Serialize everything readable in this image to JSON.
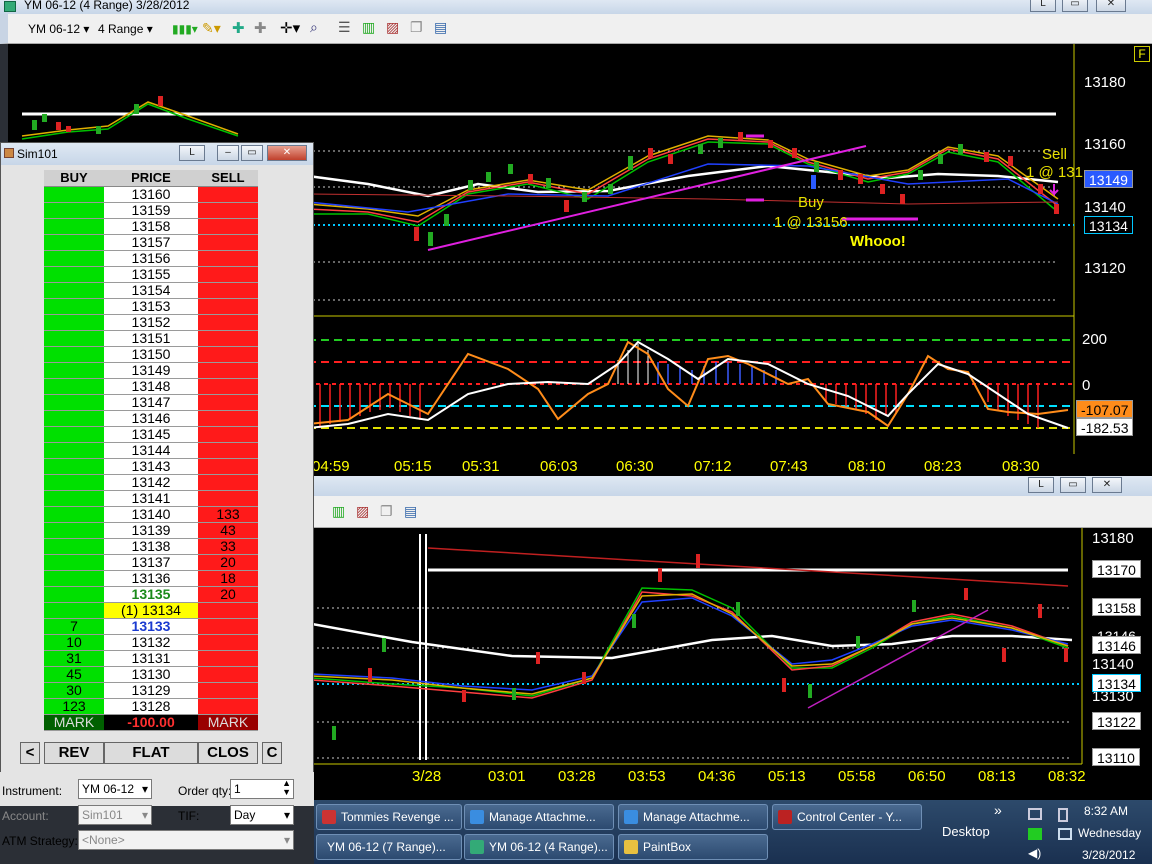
{
  "main_window": {
    "title": "YM 06-12 (4 Range)  3/28/2012",
    "instrument": "YM 06-12",
    "interval": "4 Range",
    "right_marker": "F",
    "minimize": "L"
  },
  "top_chart": {
    "price_labels": [
      "13180",
      "13160",
      "13140",
      "13120"
    ],
    "last_price_tag": "13149",
    "cyan_tag": "13134",
    "sell_text": "Sell",
    "sell_fill": "1 @ 131",
    "buy_text": "Buy",
    "buy_fill": "1 @ 13156",
    "whooo_text": "Whooo!",
    "indicator_labels": [
      "200",
      "0"
    ],
    "orange_tag": "-107.07",
    "white_tag": "-182.53",
    "time_labels": [
      "04:59",
      "05:15",
      "05:31",
      "06:03",
      "06:30",
      "07:12",
      "07:43",
      "08:10",
      "08:23",
      "08:30"
    ]
  },
  "bottom_chart": {
    "price_labels": [
      "13180",
      "13140",
      "13130"
    ],
    "tags": [
      "13170",
      "13158",
      "13146",
      "13134",
      "13122",
      "13110"
    ],
    "hidden_tag": "13146",
    "time_labels": [
      "3/28",
      "03:01",
      "03:28",
      "03:53",
      "04:36",
      "05:13",
      "05:58",
      "06:50",
      "08:13",
      "08:32"
    ],
    "minimize": "L"
  },
  "dom": {
    "title": "Sim101",
    "minimize": "L",
    "headers": {
      "buy": "BUY",
      "price": "PRICE",
      "sell": "SELL"
    },
    "rows": [
      {
        "buy": "",
        "price": "13160",
        "sell": ""
      },
      {
        "buy": "",
        "price": "13159",
        "sell": ""
      },
      {
        "buy": "",
        "price": "13158",
        "sell": ""
      },
      {
        "buy": "",
        "price": "13157",
        "sell": ""
      },
      {
        "buy": "",
        "price": "13156",
        "sell": ""
      },
      {
        "buy": "",
        "price": "13155",
        "sell": ""
      },
      {
        "buy": "",
        "price": "13154",
        "sell": ""
      },
      {
        "buy": "",
        "price": "13153",
        "sell": ""
      },
      {
        "buy": "",
        "price": "13152",
        "sell": ""
      },
      {
        "buy": "",
        "price": "13151",
        "sell": ""
      },
      {
        "buy": "",
        "price": "13150",
        "sell": ""
      },
      {
        "buy": "",
        "price": "13149",
        "sell": ""
      },
      {
        "buy": "",
        "price": "13148",
        "sell": ""
      },
      {
        "buy": "",
        "price": "13147",
        "sell": ""
      },
      {
        "buy": "",
        "price": "13146",
        "sell": ""
      },
      {
        "buy": "",
        "price": "13145",
        "sell": ""
      },
      {
        "buy": "",
        "price": "13144",
        "sell": ""
      },
      {
        "buy": "",
        "price": "13143",
        "sell": ""
      },
      {
        "buy": "",
        "price": "13142",
        "sell": ""
      },
      {
        "buy": "",
        "price": "13141",
        "sell": ""
      },
      {
        "buy": "",
        "price": "13140",
        "sell": "133"
      },
      {
        "buy": "",
        "price": "13139",
        "sell": "43"
      },
      {
        "buy": "",
        "price": "13138",
        "sell": "33"
      },
      {
        "buy": "",
        "price": "13137",
        "sell": "20"
      },
      {
        "buy": "",
        "price": "13136",
        "sell": "18"
      },
      {
        "buy": "",
        "price": "13135",
        "sell": "20",
        "style": "ask"
      },
      {
        "buy": "",
        "price": "(1) 13134",
        "sell": "",
        "style": "position"
      },
      {
        "buy": "7",
        "price": "13133",
        "sell": "",
        "style": "bid"
      },
      {
        "buy": "10",
        "price": "13132",
        "sell": ""
      },
      {
        "buy": "31",
        "price": "13131",
        "sell": ""
      },
      {
        "buy": "45",
        "price": "13130",
        "sell": ""
      },
      {
        "buy": "30",
        "price": "13129",
        "sell": ""
      },
      {
        "buy": "123",
        "price": "13128",
        "sell": ""
      }
    ],
    "mark_left": "MARK",
    "pnl": "-100.00",
    "mark_right": "MARK",
    "buttons": {
      "left": "<",
      "rev": "REV",
      "flat": "FLAT",
      "clos": "CLOS",
      "c": "C"
    },
    "form": {
      "instrument_label": "Instrument:",
      "instrument_value": "YM 06-12",
      "account_label": "Account:",
      "account_value": "Sim101",
      "atm_label": "ATM Strategy:",
      "atm_value": "<None>",
      "qty_label": "Order qty:",
      "qty_value": "1",
      "tif_label": "TIF:",
      "tif_value": "Day"
    }
  },
  "taskbar": {
    "items_row1": [
      "Tommies Revenge ...",
      "Manage Attachme...",
      "Manage Attachme...",
      "Control Center - Y..."
    ],
    "items_row2": [
      "YM 06-12 (7 Range)...",
      "YM 06-12 (4 Range)...",
      "PaintBox"
    ],
    "desktop": "Desktop",
    "chevron": "»",
    "time": "8:32 AM",
    "day": "Wednesday",
    "date": "3/28/2012"
  },
  "colors": {
    "buy_col": "#00e000",
    "sell_col": "#ff1a1a",
    "chart_bg": "#000000",
    "magenta_trend": "#e020e0",
    "cyan_level": "#00c8ff",
    "yellow_text": "#ffff00"
  }
}
